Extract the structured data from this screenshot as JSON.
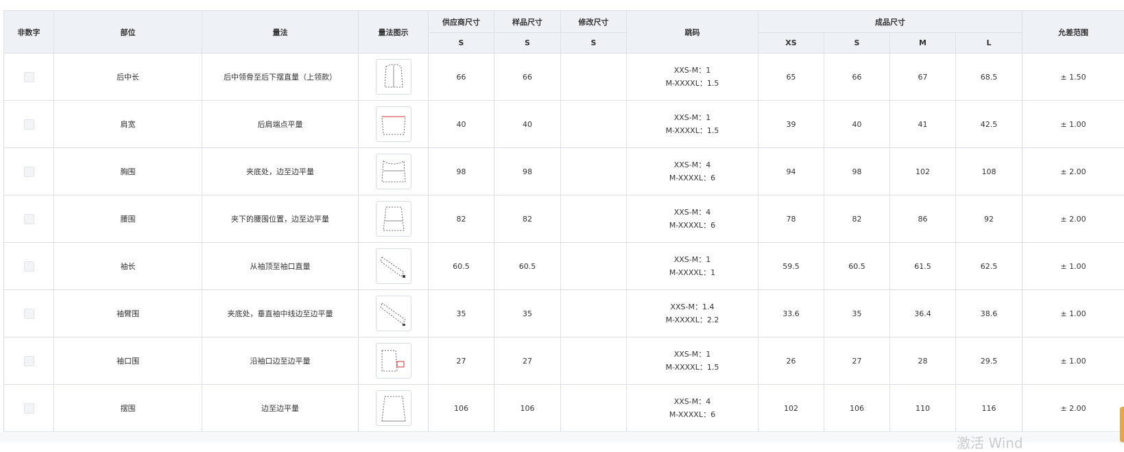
{
  "headers": {
    "non_numeric": "非数字",
    "part": "部位",
    "method": "量法",
    "diagram": "量法图示",
    "supplier_size": "供应商尺寸",
    "sample_size": "样品尺寸",
    "modified_size": "修改尺寸",
    "size_step": "跳码",
    "finished_size": "成品尺寸",
    "tolerance": "允差范围",
    "sub_supplier": "S",
    "sub_sample": "S",
    "sub_modified": "S",
    "sizes": [
      "XS",
      "S",
      "M",
      "L"
    ]
  },
  "rows": [
    {
      "part": "后中长",
      "method": "后中领骨至后下摆直量（上领款）",
      "icon": "back-length-diagram-icon",
      "supplier": "66",
      "sample": "66",
      "modified": "",
      "step1": "XXS-M：1",
      "step2": "M-XXXXL：1.5",
      "xs": "65",
      "s": "66",
      "m": "67",
      "l": "68.5",
      "tol": "± 1.50"
    },
    {
      "part": "肩宽",
      "method": "后肩端点平量",
      "icon": "shoulder-width-diagram-icon",
      "supplier": "40",
      "sample": "40",
      "modified": "",
      "step1": "XXS-M：1",
      "step2": "M-XXXXL：1.5",
      "xs": "39",
      "s": "40",
      "m": "41",
      "l": "42.5",
      "tol": "± 1.00"
    },
    {
      "part": "胸围",
      "method": "夹底处，边至边平量",
      "icon": "chest-diagram-icon",
      "supplier": "98",
      "sample": "98",
      "modified": "",
      "step1": "XXS-M：4",
      "step2": "M-XXXXL：6",
      "xs": "94",
      "s": "98",
      "m": "102",
      "l": "108",
      "tol": "± 2.00"
    },
    {
      "part": "腰围",
      "method": "夹下的腰围位置，边至边平量",
      "icon": "waist-diagram-icon",
      "supplier": "82",
      "sample": "82",
      "modified": "",
      "step1": "XXS-M：4",
      "step2": "M-XXXXL：6",
      "xs": "78",
      "s": "82",
      "m": "86",
      "l": "92",
      "tol": "± 2.00"
    },
    {
      "part": "袖长",
      "method": "从袖顶至袖口直量",
      "icon": "sleeve-length-diagram-icon",
      "supplier": "60.5",
      "sample": "60.5",
      "modified": "",
      "step1": "XXS-M：1",
      "step2": "M-XXXXL：1",
      "xs": "59.5",
      "s": "60.5",
      "m": "61.5",
      "l": "62.5",
      "tol": "± 1.00"
    },
    {
      "part": "袖臂围",
      "method": "夹底处，垂直袖中线边至边平量",
      "icon": "bicep-diagram-icon",
      "supplier": "35",
      "sample": "35",
      "modified": "",
      "step1": "XXS-M：1.4",
      "step2": "M-XXXXL：2.2",
      "xs": "33.6",
      "s": "35",
      "m": "36.4",
      "l": "38.6",
      "tol": "± 1.00"
    },
    {
      "part": "袖口围",
      "method": "沿袖口边至边平量",
      "icon": "cuff-diagram-icon",
      "supplier": "27",
      "sample": "27",
      "modified": "",
      "step1": "XXS-M：1",
      "step2": "M-XXXXL：1.5",
      "xs": "26",
      "s": "27",
      "m": "28",
      "l": "29.5",
      "tol": "± 1.00"
    },
    {
      "part": "摆围",
      "method": "边至边平量",
      "icon": "hem-diagram-icon",
      "supplier": "106",
      "sample": "106",
      "modified": "",
      "step1": "XXS-M：4",
      "step2": "M-XXXXL：6",
      "xs": "102",
      "s": "106",
      "m": "110",
      "l": "116",
      "tol": "± 2.00"
    }
  ],
  "footer_watermark": "激活 Wind"
}
